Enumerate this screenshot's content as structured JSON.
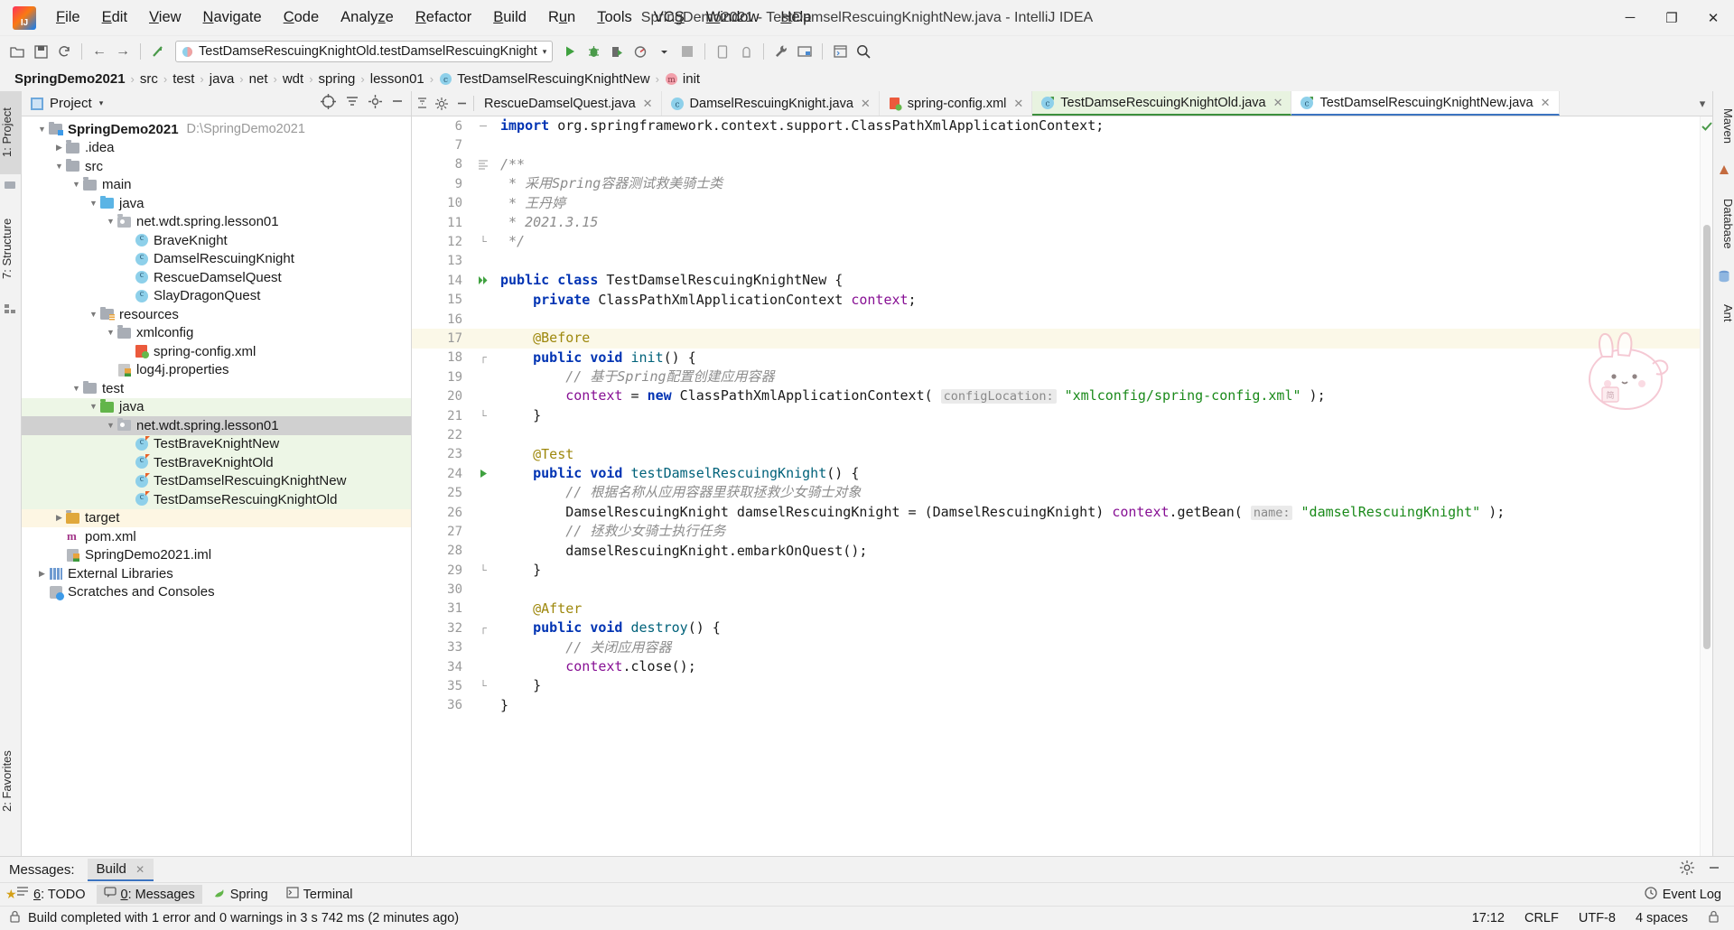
{
  "window": {
    "title": "SpringDemo2021 - TestDamselRescuingKnightNew.java - IntelliJ IDEA",
    "minimize": "─",
    "maximize": "❐",
    "close": "✕"
  },
  "menu": [
    {
      "label": "File"
    },
    {
      "label": "Edit"
    },
    {
      "label": "View"
    },
    {
      "label": "Navigate"
    },
    {
      "label": "Code"
    },
    {
      "label": "Analyze"
    },
    {
      "label": "Refactor"
    },
    {
      "label": "Build"
    },
    {
      "label": "Run"
    },
    {
      "label": "Tools"
    },
    {
      "label": "VCS"
    },
    {
      "label": "Window"
    },
    {
      "label": "Help"
    }
  ],
  "toolbar": {
    "icons_left": [
      "open-folder-icon",
      "save-icon",
      "sync-icon"
    ],
    "nav_back": "←",
    "nav_forward": "→",
    "run_config_value": "TestDamseRescuingKnightOld.testDamselRescuingKnight",
    "run_config_caret": "▾",
    "run_label": "Run",
    "debug_label": "Debug",
    "coverage_label": "Run with Coverage",
    "profile_label": "Profile",
    "stop_label": "Stop",
    "device_label": "Device Manager",
    "avd_label": "AVD Manager",
    "settings_label": "Settings",
    "project_structure_label": "Project Structure",
    "terminal_label": "Terminal",
    "search_label": "Search Everywhere"
  },
  "breadcrumb": [
    {
      "label": "SpringDemo2021",
      "bold": true,
      "icon": ""
    },
    {
      "label": "src",
      "bold": false,
      "icon": ""
    },
    {
      "label": "test",
      "bold": false,
      "icon": ""
    },
    {
      "label": "java",
      "bold": false,
      "icon": ""
    },
    {
      "label": "net",
      "bold": false,
      "icon": ""
    },
    {
      "label": "wdt",
      "bold": false,
      "icon": ""
    },
    {
      "label": "spring",
      "bold": false,
      "icon": ""
    },
    {
      "label": "lesson01",
      "bold": false,
      "icon": ""
    },
    {
      "label": "TestDamselRescuingKnightNew",
      "bold": false,
      "icon": "class-icon"
    },
    {
      "label": "init",
      "bold": false,
      "icon": "method-icon"
    }
  ],
  "left_rail": [
    {
      "label": "1: Project",
      "selected": true
    },
    {
      "label": "7: Structure",
      "selected": false
    },
    {
      "label": "2: Favorites",
      "selected": false
    }
  ],
  "right_rail": [
    {
      "label": "Maven"
    },
    {
      "label": "Database"
    },
    {
      "label": "Ant"
    }
  ],
  "project_panel": {
    "title": "Project",
    "caret": "▾",
    "tools": [
      "locate-icon",
      "collapse-all-icon",
      "settings-icon",
      "hide-icon"
    ],
    "tree": [
      {
        "indent": 0,
        "twisty": "▼",
        "icon": "folder-module",
        "label": "SpringDemo2021",
        "bold": true,
        "path": "D:\\SpringDemo2021",
        "bg": "none"
      },
      {
        "indent": 1,
        "twisty": "▶",
        "icon": "folder",
        "label": ".idea",
        "bold": false,
        "path": "",
        "bg": "none"
      },
      {
        "indent": 1,
        "twisty": "▼",
        "icon": "folder",
        "label": "src",
        "bold": false,
        "path": "",
        "bg": "none"
      },
      {
        "indent": 2,
        "twisty": "▼",
        "icon": "folder",
        "label": "main",
        "bold": false,
        "path": "",
        "bg": "none"
      },
      {
        "indent": 3,
        "twisty": "▼",
        "icon": "folder-source",
        "label": "java",
        "bold": false,
        "path": "",
        "bg": "none"
      },
      {
        "indent": 4,
        "twisty": "▼",
        "icon": "package",
        "label": "net.wdt.spring.lesson01",
        "bold": false,
        "path": "",
        "bg": "none"
      },
      {
        "indent": 5,
        "twisty": "",
        "icon": "class",
        "label": "BraveKnight",
        "bold": false,
        "path": "",
        "bg": "none"
      },
      {
        "indent": 5,
        "twisty": "",
        "icon": "class",
        "label": "DamselRescuingKnight",
        "bold": false,
        "path": "",
        "bg": "none"
      },
      {
        "indent": 5,
        "twisty": "",
        "icon": "class",
        "label": "RescueDamselQuest",
        "bold": false,
        "path": "",
        "bg": "none"
      },
      {
        "indent": 5,
        "twisty": "",
        "icon": "class",
        "label": "SlayDragonQuest",
        "bold": false,
        "path": "",
        "bg": "none"
      },
      {
        "indent": 3,
        "twisty": "▼",
        "icon": "folder-resources",
        "label": "resources",
        "bold": false,
        "path": "",
        "bg": "none"
      },
      {
        "indent": 4,
        "twisty": "▼",
        "icon": "folder",
        "label": "xmlconfig",
        "bold": false,
        "path": "",
        "bg": "none"
      },
      {
        "indent": 5,
        "twisty": "",
        "icon": "xml",
        "label": "spring-config.xml",
        "bold": false,
        "path": "",
        "bg": "none"
      },
      {
        "indent": 4,
        "twisty": "",
        "icon": "properties",
        "label": "log4j.properties",
        "bold": false,
        "path": "",
        "bg": "none"
      },
      {
        "indent": 2,
        "twisty": "▼",
        "icon": "folder",
        "label": "test",
        "bold": false,
        "path": "",
        "bg": "none"
      },
      {
        "indent": 3,
        "twisty": "▼",
        "icon": "folder-test-source",
        "label": "java",
        "bold": false,
        "path": "",
        "bg": "green"
      },
      {
        "indent": 4,
        "twisty": "▼",
        "icon": "package",
        "label": "net.wdt.spring.lesson01",
        "bold": false,
        "path": "",
        "bg": "grey"
      },
      {
        "indent": 5,
        "twisty": "",
        "icon": "test-class",
        "label": "TestBraveKnightNew",
        "bold": false,
        "path": "",
        "bg": "green"
      },
      {
        "indent": 5,
        "twisty": "",
        "icon": "test-class",
        "label": "TestBraveKnightOld",
        "bold": false,
        "path": "",
        "bg": "green"
      },
      {
        "indent": 5,
        "twisty": "",
        "icon": "test-class",
        "label": "TestDamselRescuingKnightNew",
        "bold": false,
        "path": "",
        "bg": "green"
      },
      {
        "indent": 5,
        "twisty": "",
        "icon": "test-class",
        "label": "TestDamseRescuingKnightOld",
        "bold": false,
        "path": "",
        "bg": "green"
      },
      {
        "indent": 1,
        "twisty": "▶",
        "icon": "folder-target",
        "label": "target",
        "bold": false,
        "path": "",
        "bg": "yellow"
      },
      {
        "indent": 1,
        "twisty": "",
        "icon": "maven",
        "label": "pom.xml",
        "bold": false,
        "path": "",
        "bg": "none"
      },
      {
        "indent": 1,
        "twisty": "",
        "icon": "iml",
        "label": "SpringDemo2021.iml",
        "bold": false,
        "path": "",
        "bg": "none"
      },
      {
        "indent": 0,
        "twisty": "▶",
        "icon": "library",
        "label": "External Libraries",
        "bold": false,
        "path": "",
        "bg": "none"
      },
      {
        "indent": 0,
        "twisty": "",
        "icon": "scratch",
        "label": "Scratches and Consoles",
        "bold": false,
        "path": "",
        "bg": "none"
      }
    ]
  },
  "editor": {
    "tabs": [
      {
        "label": "RescueDamselQuest.java",
        "icon": "class-icon",
        "state": "normal",
        "close": "✕"
      },
      {
        "label": "DamselRescuingKnight.java",
        "icon": "class-icon",
        "state": "normal",
        "close": "✕"
      },
      {
        "label": "spring-config.xml",
        "icon": "xml-icon",
        "state": "normal",
        "close": "✕"
      },
      {
        "label": "TestDamseRescuingKnightOld.java",
        "icon": "test-class-icon",
        "state": "active",
        "close": "✕"
      },
      {
        "label": "TestDamselRescuingKnightNew.java",
        "icon": "test-class-icon",
        "state": "current",
        "close": "✕"
      }
    ],
    "tab_overflow": "▾",
    "first_line_number": 6,
    "lines": [
      {
        "n": 6,
        "fold": "─",
        "gutter_mark": "",
        "hl": false,
        "html": "<span class=\"kw\">import</span> org.springframework.context.support.ClassPathXmlApplicationContext;"
      },
      {
        "n": 7,
        "fold": "",
        "gutter_mark": "",
        "hl": false,
        "html": ""
      },
      {
        "n": 8,
        "fold": "−",
        "gutter_mark": "doc",
        "hl": false,
        "html": "<span class=\"cm\">/**</span>"
      },
      {
        "n": 9,
        "fold": "",
        "gutter_mark": "",
        "hl": false,
        "html": " <span class=\"cm\">* 采用Spring容器测试救美骑士类</span>"
      },
      {
        "n": 10,
        "fold": "",
        "gutter_mark": "",
        "hl": false,
        "html": " <span class=\"cm\">* 王丹婷</span>"
      },
      {
        "n": 11,
        "fold": "",
        "gutter_mark": "",
        "hl": false,
        "html": " <span class=\"cm\">* 2021.3.15</span>"
      },
      {
        "n": 12,
        "fold": "└",
        "gutter_mark": "",
        "hl": false,
        "html": " <span class=\"cm\">*/</span>"
      },
      {
        "n": 13,
        "fold": "",
        "gutter_mark": "",
        "hl": false,
        "html": ""
      },
      {
        "n": 14,
        "fold": "",
        "gutter_mark": "run-all",
        "hl": false,
        "html": "<span class=\"kw\">public class</span> TestDamselRescuingKnightNew {"
      },
      {
        "n": 15,
        "fold": "",
        "gutter_mark": "",
        "hl": false,
        "html": "    <span class=\"kw\">private</span> ClassPathXmlApplicationContext <span class=\"fld-name\">context</span>;"
      },
      {
        "n": 16,
        "fold": "",
        "gutter_mark": "",
        "hl": false,
        "html": ""
      },
      {
        "n": 17,
        "fold": "",
        "gutter_mark": "",
        "hl": true,
        "html": "    <span class=\"ann\">@Before</span>"
      },
      {
        "n": 18,
        "fold": "┌",
        "gutter_mark": "",
        "hl": false,
        "html": "    <span class=\"kw\">public void</span> <span class=\"mth\">init</span>() {"
      },
      {
        "n": 19,
        "fold": "",
        "gutter_mark": "",
        "hl": false,
        "html": "        <span class=\"cm\">// 基于Spring配置创建应用容器</span>"
      },
      {
        "n": 20,
        "fold": "",
        "gutter_mark": "",
        "hl": false,
        "html": "        <span class=\"fld-name\">context</span> = <span class=\"kw\">new</span> ClassPathXmlApplicationContext( <span class=\"hint\">configLocation:</span> <span class=\"str\">\"xmlconfig/spring-config.xml\"</span> );"
      },
      {
        "n": 21,
        "fold": "└",
        "gutter_mark": "",
        "hl": false,
        "html": "    }"
      },
      {
        "n": 22,
        "fold": "",
        "gutter_mark": "",
        "hl": false,
        "html": ""
      },
      {
        "n": 23,
        "fold": "",
        "gutter_mark": "",
        "hl": false,
        "html": "    <span class=\"ann\">@Test</span>"
      },
      {
        "n": 24,
        "fold": "┌",
        "gutter_mark": "run",
        "hl": false,
        "html": "    <span class=\"kw\">public void</span> <span class=\"mth\">testDamselRescuingKnight</span>() {"
      },
      {
        "n": 25,
        "fold": "",
        "gutter_mark": "",
        "hl": false,
        "html": "        <span class=\"cm\">// 根据名称从应用容器里获取拯救少女骑士对象</span>"
      },
      {
        "n": 26,
        "fold": "",
        "gutter_mark": "",
        "hl": false,
        "html": "        DamselRescuingKnight damselRescuingKnight = (DamselRescuingKnight) <span class=\"fld-name\">context</span>.getBean( <span class=\"hint\">name:</span> <span class=\"str\">\"damselRescuingKnight\"</span> );"
      },
      {
        "n": 27,
        "fold": "",
        "gutter_mark": "",
        "hl": false,
        "html": "        <span class=\"cm\">// 拯救少女骑士执行任务</span>"
      },
      {
        "n": 28,
        "fold": "",
        "gutter_mark": "",
        "hl": false,
        "html": "        damselRescuingKnight.embarkOnQuest();"
      },
      {
        "n": 29,
        "fold": "└",
        "gutter_mark": "",
        "hl": false,
        "html": "    }"
      },
      {
        "n": 30,
        "fold": "",
        "gutter_mark": "",
        "hl": false,
        "html": ""
      },
      {
        "n": 31,
        "fold": "",
        "gutter_mark": "",
        "hl": false,
        "html": "    <span class=\"ann\">@After</span>"
      },
      {
        "n": 32,
        "fold": "┌",
        "gutter_mark": "",
        "hl": false,
        "html": "    <span class=\"kw\">public void</span> <span class=\"mth\">destroy</span>() {"
      },
      {
        "n": 33,
        "fold": "",
        "gutter_mark": "",
        "hl": false,
        "html": "        <span class=\"cm\">// 关闭应用容器</span>"
      },
      {
        "n": 34,
        "fold": "",
        "gutter_mark": "",
        "hl": false,
        "html": "        <span class=\"fld-name\">context</span>.close();"
      },
      {
        "n": 35,
        "fold": "└",
        "gutter_mark": "",
        "hl": false,
        "html": "    }"
      },
      {
        "n": 36,
        "fold": "",
        "gutter_mark": "",
        "hl": false,
        "html": "}"
      }
    ]
  },
  "bottom": {
    "messages_label": "Messages:",
    "build_tab": "Build",
    "build_close": "✕",
    "panel_icons": [
      "settings-icon",
      "hide-icon"
    ],
    "tool_windows": [
      {
        "label": "6: TODO",
        "icon": "todo-icon",
        "selected": false
      },
      {
        "label": "0: Messages",
        "icon": "messages-icon",
        "selected": true
      },
      {
        "label": "Spring",
        "icon": "spring-icon",
        "selected": false
      },
      {
        "label": "Terminal",
        "icon": "terminal-icon",
        "selected": false
      }
    ],
    "event_log": "Event Log",
    "star_icon": "favorites-star-icon"
  },
  "status": {
    "message": "Build completed with 1 error and 0 warnings in 3 s 742 ms (2 minutes ago)",
    "time": "17:12",
    "line_separator": "CRLF",
    "encoding": "UTF-8",
    "indent": "4 spaces",
    "lock_icon": "lock-icon"
  },
  "colors": {
    "accent_blue": "#3c74c1",
    "green_selection": "#edf6e6",
    "grey_selection": "#d0d0d0",
    "highlight_line": "#fbf8e8",
    "keyword": "#0033b3",
    "string": "#1a8a1a",
    "comment": "#8c8c8c",
    "annotation": "#9e880d",
    "field": "#871094"
  }
}
